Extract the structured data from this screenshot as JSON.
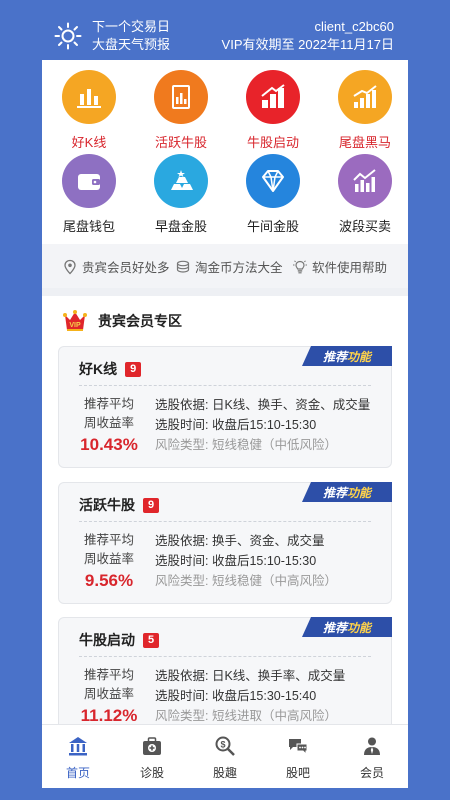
{
  "header": {
    "line1": "下一个交易日",
    "line2": "大盘天气预报",
    "client": "client_c2bc60",
    "vip": "VIP有效期至 2022年11月17日"
  },
  "grid": [
    {
      "label": "好K线",
      "icon": "bar-chart-icon",
      "color": "#f5a623"
    },
    {
      "label": "活跃牛股",
      "icon": "document-chart-icon",
      "color": "#f07a1e"
    },
    {
      "label": "牛股启动",
      "icon": "stairs-chart-icon",
      "color": "#e8232a"
    },
    {
      "label": "尾盘黑马",
      "icon": "growth-chart-icon",
      "color": "#f5a623"
    },
    {
      "label": "尾盘钱包",
      "icon": "wallet-icon",
      "color": "#8e70c2"
    },
    {
      "label": "早盘金股",
      "icon": "gold-bars-icon",
      "color": "#2aa8e0"
    },
    {
      "label": "午间金股",
      "icon": "diamond-icon",
      "color": "#2585dd"
    },
    {
      "label": "波段买卖",
      "icon": "wave-chart-icon",
      "color": "#9b6bbf"
    }
  ],
  "links": [
    {
      "label": "贵宾会员好处多",
      "icon": "location-pin-icon"
    },
    {
      "label": "淘金币方法大全",
      "icon": "coins-icon"
    },
    {
      "label": "软件使用帮助",
      "icon": "lightbulb-icon"
    }
  ],
  "vip_section": {
    "title": "贵宾会员专区",
    "recommend_a": "推荐",
    "recommend_b": "功能"
  },
  "cards": [
    {
      "name": "好K线",
      "count": "9",
      "ret_label1": "推荐平均",
      "ret_label2": "周收益率",
      "ret": "10.43%",
      "basis": "选股依据:  日K线、换手、资金、成交量",
      "time": "选股时间:  收盘后15:10-15:30",
      "risk": "风险类型:  短线稳健（中低风险）"
    },
    {
      "name": "活跃牛股",
      "count": "9",
      "ret_label1": "推荐平均",
      "ret_label2": "周收益率",
      "ret": "9.56%",
      "basis": "选股依据:  换手、资金、成交量",
      "time": "选股时间:  收盘后15:10-15:30",
      "risk": "风险类型:  短线稳健（中高风险）"
    },
    {
      "name": "牛股启动",
      "count": "5",
      "ret_label1": "推荐平均",
      "ret_label2": "周收益率",
      "ret": "11.12%",
      "basis": "选股依据:  日K线、换手率、成交量",
      "time": "选股时间:  收盘后15:30-15:40",
      "risk": "风险类型:  短线进取（中高风险）"
    }
  ],
  "tabs": [
    {
      "label": "首页",
      "icon": "bank-icon"
    },
    {
      "label": "诊股",
      "icon": "medical-kit-icon"
    },
    {
      "label": "股趣",
      "icon": "money-search-icon"
    },
    {
      "label": "股吧",
      "icon": "chat-bubbles-icon"
    },
    {
      "label": "会员",
      "icon": "person-icon"
    }
  ],
  "colors": {
    "accent": "#3b63c4",
    "red": "#d8262d",
    "header_bg": "#4a72c9"
  }
}
